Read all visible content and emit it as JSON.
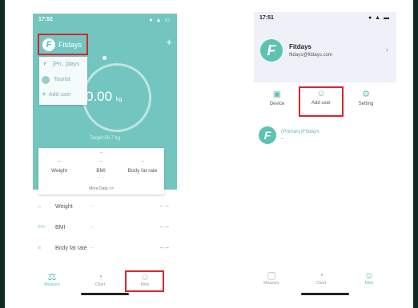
{
  "left": {
    "status_time": "17:52",
    "status_icons": "● ▲ ▭",
    "brand_name": "Fitdays",
    "add_symbol": "+",
    "dropdown": [
      {
        "label": "[Pri...]days"
      },
      {
        "label": "Tourist"
      },
      {
        "label": "Add user"
      }
    ],
    "weight_value": "0.00",
    "weight_unit": "kg",
    "target": "Target:56.7 kg",
    "card": {
      "top_dash": "--",
      "cols": [
        {
          "value": "--",
          "label": "Weight"
        },
        {
          "value": "--",
          "label": "BMI"
        },
        {
          "value": "--",
          "label": "Body fat rate"
        }
      ],
      "sub": "-- --",
      "more": "More Data >>"
    },
    "rows": [
      {
        "icon": "⌂",
        "label": "Weight",
        "v1": "--",
        "v2": "-- --"
      },
      {
        "icon": "BMI",
        "label": "BMI",
        "v1": "--",
        "v2": "-- --"
      },
      {
        "icon": "≡",
        "label": "Body fat rate",
        "v1": "--",
        "v2": "-- --"
      }
    ],
    "tabs": [
      {
        "icon": "⚖",
        "label": "Measure"
      },
      {
        "icon": "◔",
        "label": "Chart"
      },
      {
        "icon": "☺",
        "label": "Mine"
      }
    ]
  },
  "right": {
    "status_time": "17:51",
    "status_icons": "● ▲ ▬",
    "user_name": "Fitdays",
    "user_email": "fitdays@fitdays.com",
    "chevron": "›",
    "menu": [
      {
        "icon": "▣",
        "label": "Device"
      },
      {
        "icon": "☺",
        "label": "Add  user"
      },
      {
        "icon": "⚙",
        "label": "Setting"
      }
    ],
    "member_name": "(Primary)Fitdays",
    "member_sub": "--",
    "tabs": [
      {
        "icon": "▢",
        "label": "Measure"
      },
      {
        "icon": "◔",
        "label": "Chart"
      },
      {
        "icon": "☺",
        "label": "Mine"
      }
    ]
  },
  "colors": {
    "accent": "#73c6bf",
    "highlight": "#d7262c"
  }
}
